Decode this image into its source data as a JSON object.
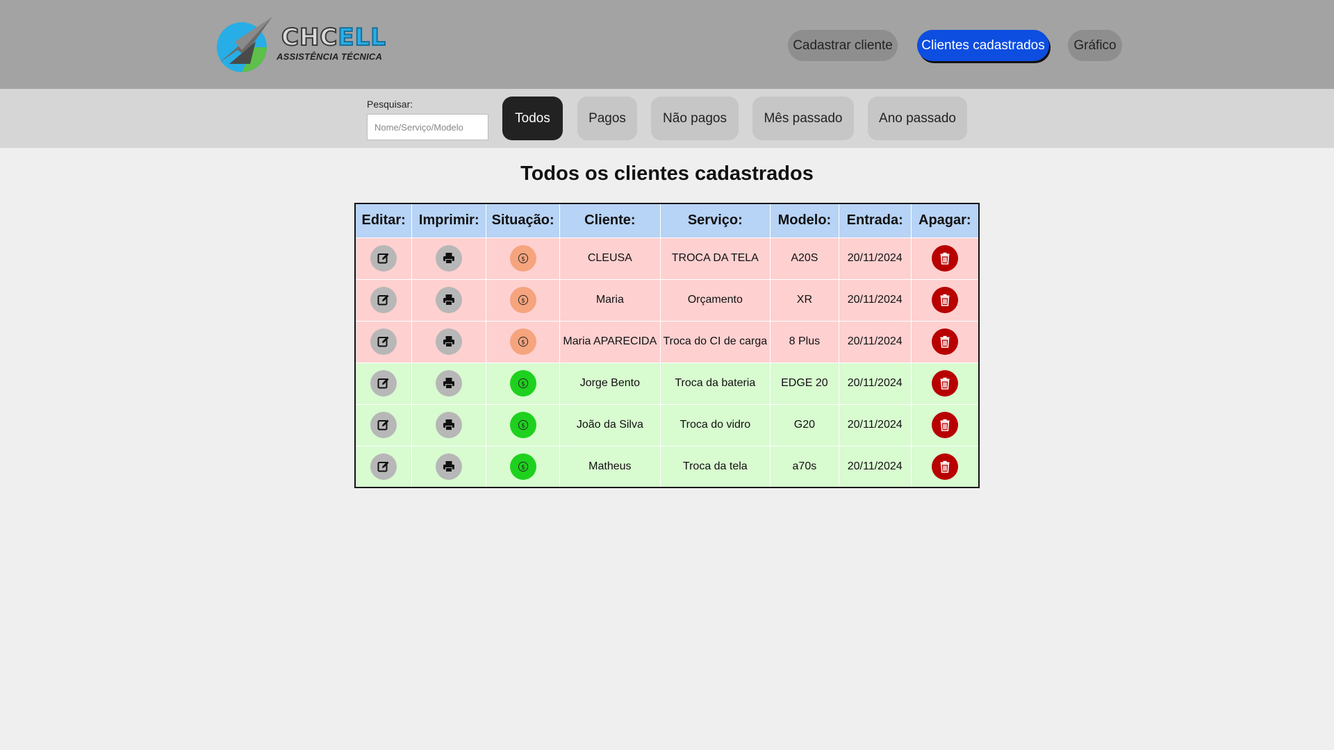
{
  "brand": {
    "name_part1": "CHC",
    "name_part2": "ELL",
    "subtitle": "ASSISTÊNCIA TÉCNICA",
    "accent_blue": "#27aee6",
    "accent_green": "#5cc04a"
  },
  "nav": {
    "items": [
      {
        "label": "Cadastrar cliente",
        "active": false
      },
      {
        "label": "Clientes cadastrados",
        "active": true
      },
      {
        "label": "Gráfico",
        "active": false
      }
    ]
  },
  "filters": {
    "search_label": "Pesquisar:",
    "search_placeholder": "Nome/Serviço/Modelo",
    "search_value": "",
    "buttons": [
      {
        "label": "Todos",
        "active": true
      },
      {
        "label": "Pagos",
        "active": false
      },
      {
        "label": "Não pagos",
        "active": false
      },
      {
        "label": "Mês passado",
        "active": false
      },
      {
        "label": "Ano passado",
        "active": false
      }
    ]
  },
  "main": {
    "title": "Todos os clientes cadastrados",
    "columns": [
      "Editar:",
      "Imprimir:",
      "Situação:",
      "Cliente:",
      "Serviço:",
      "Modelo:",
      "Entrada:",
      "Apagar:"
    ],
    "rows": [
      {
        "status": "unpaid",
        "cliente": "CLEUSA",
        "servico": "TROCA DA TELA",
        "modelo": "A20S",
        "entrada": "20/11/2024"
      },
      {
        "status": "unpaid",
        "cliente": "Maria",
        "servico": "Orçamento",
        "modelo": "XR",
        "entrada": "20/11/2024"
      },
      {
        "status": "unpaid",
        "cliente": "Maria APARECIDA",
        "servico": "Troca do CI de carga",
        "modelo": "8 Plus",
        "entrada": "20/11/2024"
      },
      {
        "status": "paid",
        "cliente": "Jorge Bento",
        "servico": "Troca da bateria",
        "modelo": "EDGE 20",
        "entrada": "20/11/2024"
      },
      {
        "status": "paid",
        "cliente": "João da Silva",
        "servico": "Troca do vidro",
        "modelo": "G20",
        "entrada": "20/11/2024"
      },
      {
        "status": "paid",
        "cliente": "Matheus",
        "servico": "Troca da tela",
        "modelo": "a70s",
        "entrada": "20/11/2024"
      }
    ],
    "icons": {
      "edit": "edit-icon",
      "print": "printer-icon",
      "status": "dollar-circle-icon",
      "delete": "trash-icon"
    },
    "colors": {
      "unpaid_row": "#ffd0d0",
      "paid_row": "#d8fbd0",
      "unpaid_status": "#f5a47d",
      "paid_status": "#1ed11e",
      "delete": "#b80000",
      "header_bg": "#b7d3f5",
      "active_nav": "#0d4de0"
    }
  }
}
